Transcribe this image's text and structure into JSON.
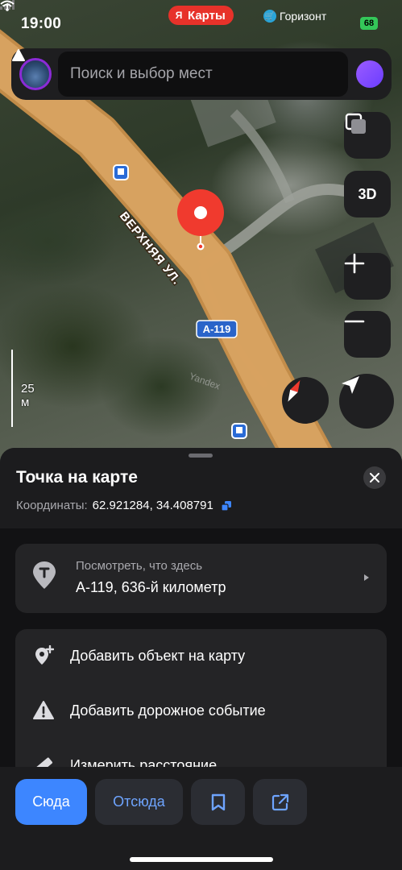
{
  "status_bar": {
    "time": "19:00",
    "app_pill": "Карты",
    "app_pill_logo": "Я",
    "carrier": "Горизонт",
    "battery": "68",
    "accent_colors": {
      "app_pill": "#e7322a",
      "battery": "#34c759"
    }
  },
  "search": {
    "placeholder": "Поиск и выбор мест"
  },
  "map": {
    "street_label": "ВЕРХНЯЯ УЛ.",
    "route_shield": "А-119",
    "watermark": "Yandex",
    "scale_label": "25 м",
    "buttons": {
      "three_d": "3D",
      "plus": "+",
      "minus": "−"
    },
    "marker_color": "#f03a2e"
  },
  "sheet": {
    "title": "Точка на карте",
    "coords_label": "Координаты:",
    "coords_value": "62.921284, 34.408791",
    "whats_here": {
      "subtitle": "Посмотреть, что здесь",
      "value": "А-119, 636-й километр"
    },
    "actions": [
      {
        "label": "Добавить объект на карту",
        "icon": "map-pin-plus-icon"
      },
      {
        "label": "Добавить дорожное событие",
        "icon": "warning-triangle-icon"
      },
      {
        "label": "Измерить расстояние",
        "icon": "ruler-icon"
      }
    ]
  },
  "bottom_bar": {
    "here": "Сюда",
    "from": "Отсюда",
    "accent": "#3d86ff"
  }
}
